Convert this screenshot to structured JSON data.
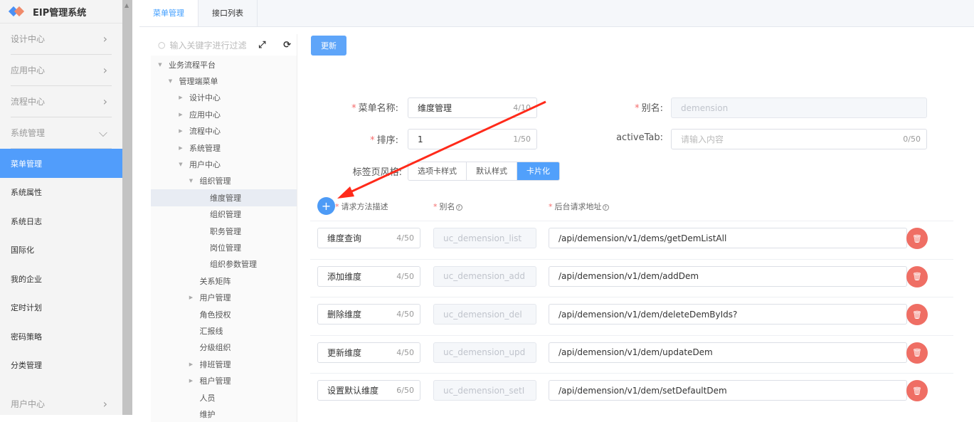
{
  "app": {
    "title": "EIP管理系统"
  },
  "sidebar": {
    "groups_top": [
      {
        "label": "设计中心"
      },
      {
        "label": "应用中心"
      },
      {
        "label": "流程中心"
      }
    ],
    "expanded_group": {
      "label": "系统管理"
    },
    "items": [
      {
        "label": "菜单管理",
        "active": true
      },
      {
        "label": "系统属性"
      },
      {
        "label": "系统日志"
      },
      {
        "label": "国际化"
      },
      {
        "label": "我的企业"
      },
      {
        "label": "定时计划"
      },
      {
        "label": "密码策略"
      },
      {
        "label": "分类管理"
      }
    ],
    "bottom_group": {
      "label": "用户中心"
    }
  },
  "tabs": [
    {
      "label": "菜单管理",
      "active": true
    },
    {
      "label": "接口列表"
    }
  ],
  "tree": {
    "search_placeholder": "输入关键字进行过滤",
    "nodes": [
      {
        "label": "业务流程平台",
        "level": 0,
        "arrow": "down"
      },
      {
        "label": "管理端菜单",
        "level": 1,
        "arrow": "down"
      },
      {
        "label": "设计中心",
        "level": 2,
        "arrow": "right"
      },
      {
        "label": "应用中心",
        "level": 2,
        "arrow": "right"
      },
      {
        "label": "流程中心",
        "level": 2,
        "arrow": "right"
      },
      {
        "label": "系统管理",
        "level": 2,
        "arrow": "right"
      },
      {
        "label": "用户中心",
        "level": 2,
        "arrow": "down"
      },
      {
        "label": "组织管理",
        "level": 3,
        "arrow": "down"
      },
      {
        "label": "维度管理",
        "level": 4,
        "arrow": "",
        "selected": true
      },
      {
        "label": "组织管理",
        "level": 4,
        "arrow": ""
      },
      {
        "label": "职务管理",
        "level": 4,
        "arrow": ""
      },
      {
        "label": "岗位管理",
        "level": 4,
        "arrow": ""
      },
      {
        "label": "组织参数管理",
        "level": 4,
        "arrow": ""
      },
      {
        "label": "关系矩阵",
        "level": 3,
        "arrow": ""
      },
      {
        "label": "用户管理",
        "level": 3,
        "arrow": "right"
      },
      {
        "label": "角色授权",
        "level": 3,
        "arrow": ""
      },
      {
        "label": "汇报线",
        "level": 3,
        "arrow": ""
      },
      {
        "label": "分级组织",
        "level": 3,
        "arrow": ""
      },
      {
        "label": "排班管理",
        "level": 3,
        "arrow": "right"
      },
      {
        "label": "租户管理",
        "level": 3,
        "arrow": "right"
      },
      {
        "label": "人员",
        "level": 3,
        "arrow": ""
      },
      {
        "label": "维护",
        "level": 3,
        "arrow": ""
      }
    ]
  },
  "form": {
    "update_label": "更新",
    "menu_name": {
      "label": "菜单名称:",
      "value": "维度管理",
      "count": "4/10"
    },
    "alias": {
      "label": "别名:",
      "value": "demension"
    },
    "sort": {
      "label": "排序:",
      "value": "1",
      "count": "1/50"
    },
    "active_tab": {
      "label": "activeTab:",
      "placeholder": "请输入内容",
      "count": "0/50"
    },
    "tab_style": {
      "label": "标签页风格:",
      "options": [
        "选项卡样式",
        "默认样式",
        "卡片化"
      ],
      "selected": "卡片化"
    },
    "columns": {
      "desc": "请求方法描述",
      "alias": "别名",
      "url": "后台请求地址"
    },
    "rows": [
      {
        "desc": "维度查询",
        "count": "4/50",
        "alias": "uc_demension_list",
        "url": "/api/demension/v1/dems/getDemListAll"
      },
      {
        "desc": "添加维度",
        "count": "4/50",
        "alias": "uc_demension_add",
        "url": "/api/demension/v1/dem/addDem"
      },
      {
        "desc": "删除维度",
        "count": "4/50",
        "alias": "uc_demension_del",
        "url": "/api/demension/v1/dem/deleteDemByIds?"
      },
      {
        "desc": "更新维度",
        "count": "4/50",
        "alias": "uc_demension_upd",
        "url": "/api/demension/v1/dem/updateDem"
      },
      {
        "desc": "设置默认维度",
        "count": "6/50",
        "alias": "uc_demension_setI",
        "url": "/api/demension/v1/dem/setDefaultDem"
      }
    ]
  },
  "colors": {
    "primary": "#409eff",
    "sidebar_active": "#519dfb",
    "danger": "#ef6e64",
    "annotation": "#ff2a1a"
  }
}
